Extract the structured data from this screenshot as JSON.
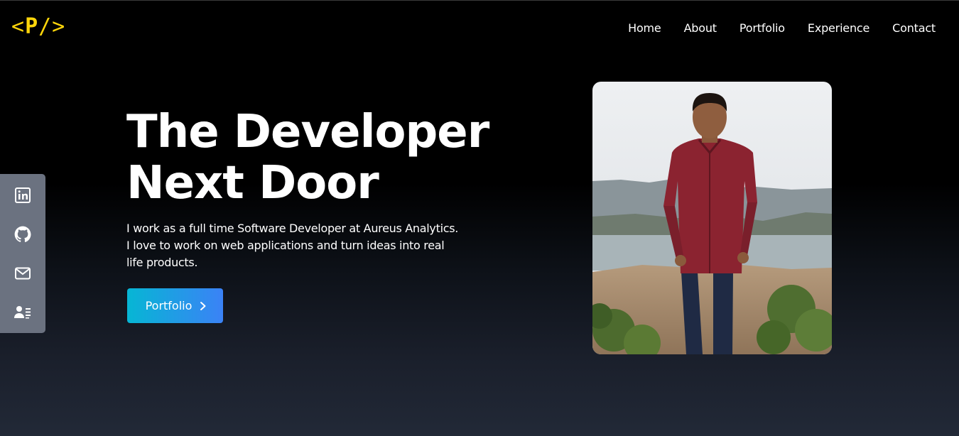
{
  "logo": {
    "text_open": "<",
    "text_letter": "P",
    "text_close": "/>"
  },
  "nav": {
    "items": [
      {
        "label": "Home"
      },
      {
        "label": "About"
      },
      {
        "label": "Portfolio"
      },
      {
        "label": "Experience"
      },
      {
        "label": "Contact"
      }
    ]
  },
  "social": {
    "icons": [
      "linkedin-icon",
      "github-icon",
      "mail-icon",
      "resume-icon"
    ]
  },
  "hero": {
    "title_line1": "The Developer",
    "title_line2": "Next Door",
    "description": "I work as a full time Software Developer at Aureus Analytics. I love to work on web applications and turn ideas into real life products.",
    "cta_label": "Portfolio"
  },
  "colors": {
    "logo": "#ffd60a",
    "cta_start": "#06b6d4",
    "cta_end": "#3b82f6",
    "social_bar": "#6b7280"
  }
}
